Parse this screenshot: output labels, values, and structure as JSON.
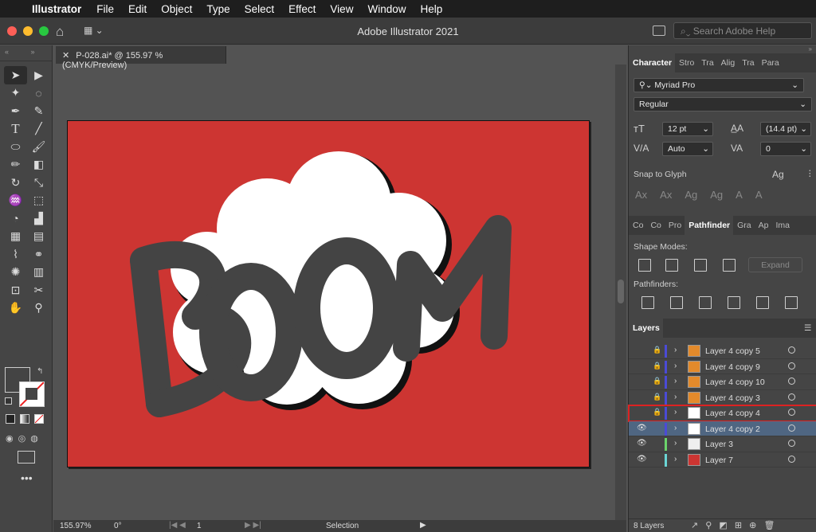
{
  "menubar": {
    "app": "Illustrator",
    "items": [
      "File",
      "Edit",
      "Object",
      "Type",
      "Select",
      "Effect",
      "View",
      "Window",
      "Help"
    ]
  },
  "window": {
    "title": "Adobe Illustrator 2021",
    "search_placeholder": "Search Adobe Help"
  },
  "document_tab": {
    "label": "P-028.ai* @ 155.97 % (CMYK/Preview)"
  },
  "status": {
    "zoom": "155.97%",
    "rotation": "0°",
    "artboard": "1",
    "tool": "Selection"
  },
  "character": {
    "tabs": [
      "Character",
      "Stro",
      "Tra",
      "Alig",
      "Tra",
      "Para"
    ],
    "font": "Myriad Pro",
    "style": "Regular",
    "size": "12 pt",
    "leading": "(14.4 pt)",
    "kerning": "Auto",
    "tracking": "0",
    "snap_label": "Snap to Glyph"
  },
  "pathfinder": {
    "tabs": [
      "Co",
      "Co",
      "Pro",
      "Pathfinder",
      "Gra",
      "Ap",
      "Ima"
    ],
    "shape_modes_label": "Shape Modes:",
    "expand_label": "Expand",
    "pathfinders_label": "Pathfinders:"
  },
  "layers": {
    "tab": "Layers",
    "count_label": "8 Layers",
    "rows": [
      {
        "name": "Layer 4 copy 5",
        "visible": false,
        "locked": true,
        "color": "#4b4bd6",
        "thumb": "M"
      },
      {
        "name": "Layer 4 copy 9",
        "visible": false,
        "locked": true,
        "color": "#4b4bd6",
        "thumb": "O"
      },
      {
        "name": "Layer 4 copy 10",
        "visible": false,
        "locked": true,
        "color": "#4b4bd6",
        "thumb": "O"
      },
      {
        "name": "Layer 4 copy 3",
        "visible": false,
        "locked": true,
        "color": "#4b4bd6",
        "thumb": "B"
      },
      {
        "name": "Layer 4 copy 4",
        "visible": false,
        "locked": true,
        "color": "#4b4bd6",
        "thumb": "BOOM",
        "target": true
      },
      {
        "name": "Layer 4 copy 2",
        "visible": true,
        "locked": false,
        "color": "#4b4bd6",
        "thumb": "BOOM",
        "selected": true
      },
      {
        "name": "Layer 3",
        "visible": true,
        "locked": false,
        "color": "#6bd46b",
        "thumb": ""
      },
      {
        "name": "Layer 7",
        "visible": true,
        "locked": false,
        "color": "#6bd6d6",
        "thumb": ""
      }
    ]
  },
  "artwork": {
    "text": "BOOM",
    "background": "#cd3532",
    "letter_color": "#444444",
    "cloud_color": "#ffffff"
  }
}
